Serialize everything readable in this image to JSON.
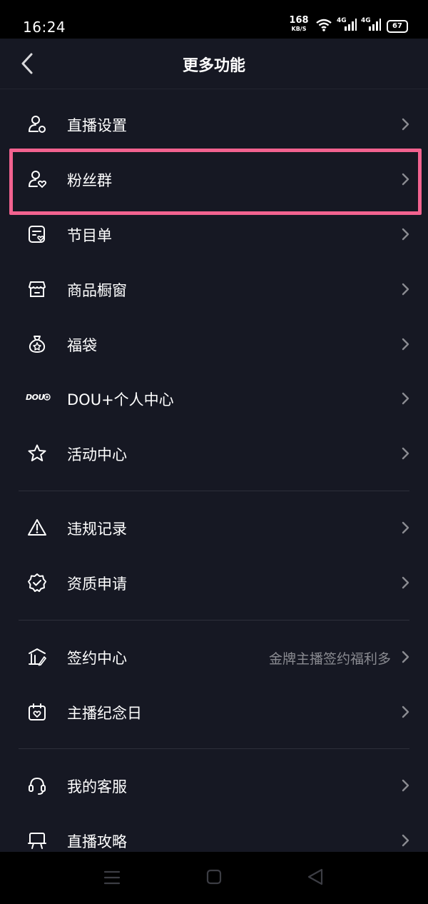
{
  "status": {
    "time": "16:24",
    "net_speed_value": "168",
    "net_speed_unit": "KB/S",
    "network1": "4G",
    "network2": "4G",
    "battery": "67"
  },
  "header": {
    "title": "更多功能",
    "back_icon": "chevron-left-icon"
  },
  "menu": [
    {
      "label": "直播设置",
      "icon": "user-settings-icon"
    },
    {
      "label": "粉丝群",
      "icon": "user-heart-icon"
    },
    {
      "label": "节目单",
      "icon": "program-list-icon"
    },
    {
      "label": "商品橱窗",
      "icon": "storefront-icon"
    },
    {
      "label": "福袋",
      "icon": "lucky-bag-icon"
    },
    {
      "label": "DOU+个人中心",
      "icon": "dou-plus-icon"
    },
    {
      "label": "活动中心",
      "icon": "star-icon"
    },
    {
      "label": "违规记录",
      "icon": "warning-icon"
    },
    {
      "label": "资质申请",
      "icon": "verified-badge-icon"
    },
    {
      "label": "签约中心",
      "icon": "contract-building-icon",
      "hint": "金牌主播签约福利多"
    },
    {
      "label": "主播纪念日",
      "icon": "calendar-heart-icon"
    },
    {
      "label": "我的客服",
      "icon": "headset-icon"
    },
    {
      "label": "直播攻略",
      "icon": "presentation-board-icon"
    }
  ],
  "dou_icon_text": "DOU",
  "colors": {
    "background": "#161823",
    "highlight": "#f2628f",
    "text": "#ffffff",
    "hint": "#8a8b91"
  },
  "navbar": {
    "icons": [
      "menu-icon",
      "home-square-icon",
      "back-triangle-icon"
    ]
  }
}
